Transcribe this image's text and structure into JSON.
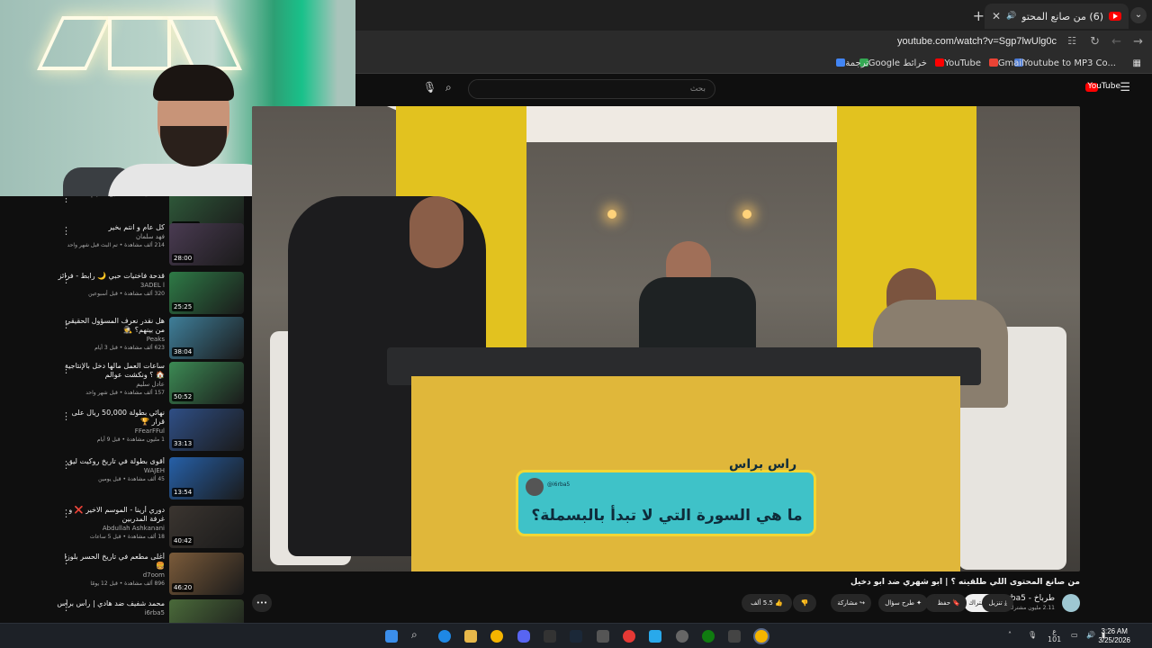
{
  "browser": {
    "tab_title": "(6) من صانع المحتوى اللي طا",
    "url": "youtube.com/watch?v=Sgp7lwUlg0c",
    "bookmarks": [
      "Youtube to MP3 Co...",
      "Gmail",
      "YouTube",
      "Google خرائط",
      "ترجمة"
    ]
  },
  "youtube_header": {
    "search_placeholder": "بحث",
    "logo_text": "YouTube"
  },
  "sidebar": {
    "items": [
      {
        "title": "",
        "channel": "",
        "stats": "239 ألف مشاهدة • قبل 10 أيام",
        "duration": "1:30:01",
        "thumb": "#2f5a3a"
      },
      {
        "title": "كل عام و انتم بخير",
        "channel": "فهد سلمان",
        "stats": "214 ألف مشاهدة • تم البث قبل شهر واحد",
        "duration": "28:00",
        "thumb": "#4a3b52"
      },
      {
        "title": "قدحة فاختيات حبي 🌙 رابط - فرائز",
        "channel": "3ADEL l",
        "stats": "320 ألف مشاهدة • قبل أسبوعين",
        "duration": "25:25",
        "thumb": "#2e7a46"
      },
      {
        "title": "هل نقدر نعرف المسؤول الحقيقي من بينهم؟ 🕵️",
        "channel": "Peaks",
        "stats": "623 ألف مشاهدة • قبل 3 أيام",
        "duration": "38:04",
        "thumb": "#3f7f9a"
      },
      {
        "title": "ساعات العمل مالها دخل بالإنتاجية 🏠 ؟ ونكشت عوالم",
        "channel": "عادل سليم",
        "stats": "157 ألف مشاهدة • قبل شهر واحد",
        "duration": "50:52",
        "thumb": "#3c8a54"
      },
      {
        "title": "نهائي بطولة 50,000 ريال على قرار 🏆",
        "channel": "FFearFFul",
        "stats": "1 مليون مشاهدة • قبل 9 أيام",
        "duration": "33:13",
        "thumb": "#2f4f86"
      },
      {
        "title": "أقوى بطولة في تاريخ روكيت ليق",
        "channel": "WAJEH",
        "stats": "45 ألف مشاهدة • قبل يومين",
        "duration": "13:54",
        "thumb": "#2660a8"
      },
      {
        "title": "دوري أرينا - الموسم الاخير ❌ و غرفة المدربين",
        "channel": "Abdullah Ashkanani",
        "stats": "18 ألف مشاهدة • قبل 5 ساعات",
        "duration": "40:42",
        "thumb": "#3b3530"
      },
      {
        "title": "أغلى مطعم في تاريخ الحسر بلوزا 🍔",
        "channel": "d7oom",
        "stats": "896 ألف مشاهدة • قبل 12 يومًا",
        "duration": "46:20",
        "thumb": "#7b5b3a"
      },
      {
        "title": "محمد شفيف ضد هادي | رأس برأس",
        "channel": "i6rba5",
        "stats": "",
        "duration": "",
        "thumb": "#4a6a3a"
      }
    ]
  },
  "video": {
    "card_handle": "@i6rba5",
    "card_question": "ما هي السورة التي لا تبدأ بالبسملة؟",
    "card_logo": "راس براس",
    "title": "من صانع المحتوى اللي طلقيته ؟ | ابو شهري ضد ابو دخيل",
    "channel_name": "طرباخ - i6rba5",
    "subscribers": "2.11 مليون مشترك",
    "subscribe_label": "الاشتراك",
    "likes": "5.5 ألف",
    "share_label": "مشاركة",
    "ask_label": "طرح سؤال",
    "save_label": "حفظ",
    "download_label": "تنزيل",
    "more_label": "•••"
  },
  "taskbar": {
    "lang": "ع",
    "lang_sub": "101",
    "time": "3:26 AM",
    "date": "3/25/2026"
  }
}
